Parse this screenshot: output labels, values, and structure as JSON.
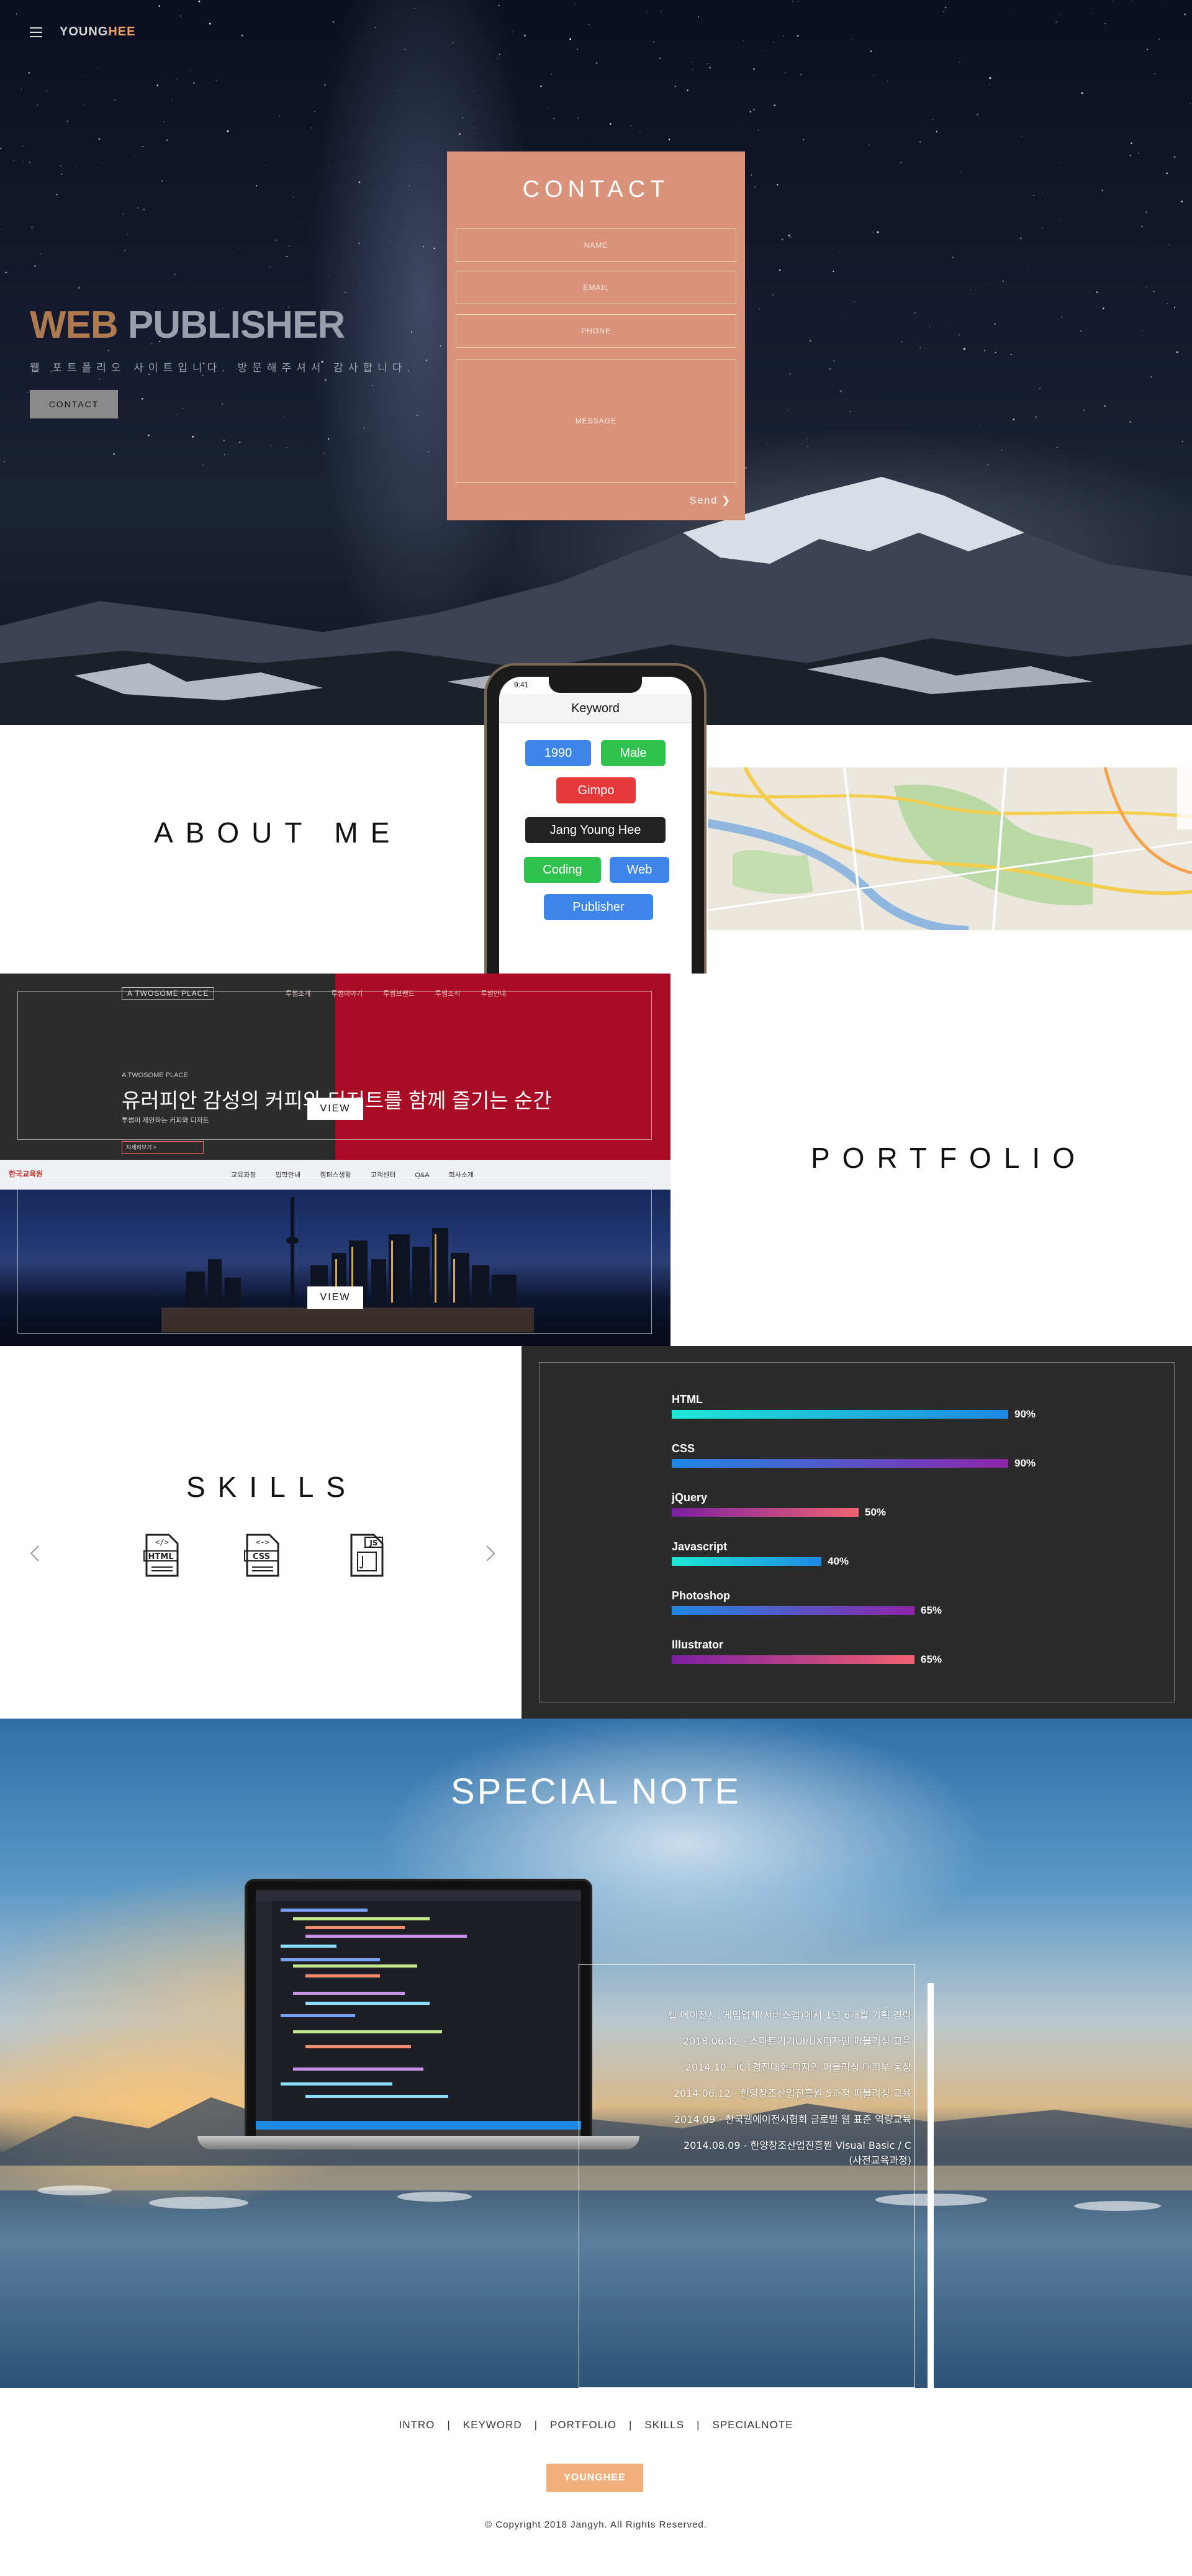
{
  "header": {
    "logo_prefix": "YOUNG",
    "logo_suffix": "HEE"
  },
  "hero": {
    "title_part1": "WEB",
    "title_part2": " PUBLISHER",
    "subtitle": "웹 포트폴리오 사이트입니다. 방문해주셔서 감사합니다.",
    "contact_button": "CONTACT"
  },
  "contact_form": {
    "title": "CONTACT",
    "name_placeholder": "NAME",
    "email_placeholder": "EMAIL",
    "phone_placeholder": "PHONE",
    "message_placeholder": "MESSAGE",
    "send_label": "Send ❯"
  },
  "about": {
    "title": "ABOUT ME",
    "phone_time": "9:41",
    "keyword_title": "Keyword",
    "keywords": [
      "1990",
      "Male",
      "Gimpo",
      "Jang Young Hee",
      "Coding",
      "Web",
      "Publisher"
    ]
  },
  "portfolio": {
    "title": "PORTFOLIO",
    "project1": {
      "brand": "A TWOSOME PLACE",
      "menu": [
        "투썸소개",
        "투썸이야기",
        "투썸브랜드",
        "투썸소식",
        "투썸안내"
      ],
      "small": "A TWOSOME PLACE",
      "headline": "유러피안 감성의 커피와 디저트를 함께 즐기는 순간",
      "caption": "투썸이 제안하는 커피와 디저트",
      "mini_button": "자세히보기 >",
      "view": "VIEW"
    },
    "project2": {
      "brand": "한국교육원",
      "menu": [
        "교육과정",
        "입학안내",
        "캠퍼스생활",
        "고객센터",
        "Q&A",
        "회사소개"
      ],
      "view": "VIEW"
    }
  },
  "skills": {
    "title": "SKILLS",
    "icons": [
      "html-file-icon",
      "css-file-icon",
      "js-file-icon"
    ],
    "icon_labels": [
      "HTML",
      "CSS",
      "JS"
    ],
    "items": [
      {
        "name": "HTML",
        "percent": 90,
        "label": "90%",
        "from": "#1de9d6",
        "to": "#1e88e5"
      },
      {
        "name": "CSS",
        "percent": 90,
        "label": "90%",
        "from": "#1e88e5",
        "to": "#8e24aa"
      },
      {
        "name": "jQuery",
        "percent": 50,
        "label": "50%",
        "from": "#7b1fa2",
        "to": "#f06270"
      },
      {
        "name": "Javascript",
        "percent": 40,
        "label": "40%",
        "from": "#1de9d6",
        "to": "#1e88e5"
      },
      {
        "name": "Photoshop",
        "percent": 65,
        "label": "65%",
        "from": "#1e88e5",
        "to": "#8e24aa"
      },
      {
        "name": "Illustrator",
        "percent": 65,
        "label": "65%",
        "from": "#7b1fa2",
        "to": "#f06270"
      }
    ]
  },
  "special_note": {
    "title": "SPECIAL NOTE",
    "notes": [
      "웹 에이전시, 게임업체(서버스엠)에서 1년 6개월 기획 경력",
      "2018.06.12 - 스마트기기UI/UX디자인 퍼블리싱 교육",
      "2014.10 - ICT경진대회-디자인 퍼블리싱 대회부 동상",
      "2014.06.12 - 한양창조산업진흥원 5과정 퍼블리싱 교육",
      "2014.09 - 한국웹에이전시협회 글로벌 웹 표준 역량교육",
      "2014.08.09 - 한양창조산업진흥원 Visual Basic / C",
      "(사전교육과정)"
    ]
  },
  "footer": {
    "nav": [
      "INTRO",
      "KEYWORD",
      "PORTFOLIO",
      "SKILLS",
      "SPECIALNOTE"
    ],
    "logo_prefix": "YOUNG",
    "logo_suffix": "HEE",
    "copyright": "© Copyright 2018 Jangyh. All Rights Reserved."
  },
  "colors": {
    "contact_bg": "#d9937a",
    "portfolio_red": "#a80d25",
    "skills_bg": "#2b2b2b",
    "footer_logo_bg": "#f2b07d"
  }
}
